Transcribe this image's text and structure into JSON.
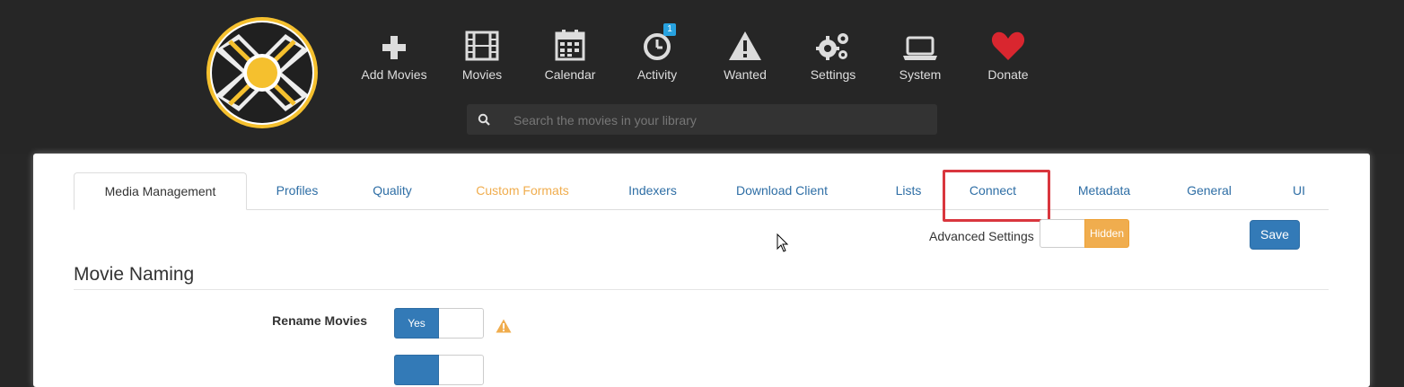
{
  "header": {
    "nav": [
      {
        "label": "Add Movies",
        "icon": "plus-icon"
      },
      {
        "label": "Movies",
        "icon": "film-icon"
      },
      {
        "label": "Calendar",
        "icon": "calendar-icon"
      },
      {
        "label": "Activity",
        "icon": "clock-icon",
        "badge": "1"
      },
      {
        "label": "Wanted",
        "icon": "warning-icon"
      },
      {
        "label": "Settings",
        "icon": "gears-icon"
      },
      {
        "label": "System",
        "icon": "laptop-icon"
      },
      {
        "label": "Donate",
        "icon": "heart-icon"
      }
    ],
    "search": {
      "placeholder": "Search the movies in your library"
    }
  },
  "tabs": [
    {
      "label": "Media Management",
      "active": true
    },
    {
      "label": "Profiles"
    },
    {
      "label": "Quality"
    },
    {
      "label": "Custom Formats"
    },
    {
      "label": "Indexers"
    },
    {
      "label": "Download Client"
    },
    {
      "label": "Lists"
    },
    {
      "label": "Connect"
    },
    {
      "label": "Metadata"
    },
    {
      "label": "General"
    },
    {
      "label": "UI"
    }
  ],
  "advanced": {
    "label": "Advanced Settings",
    "state_label": "Hidden"
  },
  "save_label": "Save",
  "section": {
    "title": "Movie Naming"
  },
  "fields": [
    {
      "label": "Rename Movies",
      "toggle_label": "Yes"
    }
  ],
  "colors": {
    "accent": "#337ab7",
    "warning": "#f0ad4e",
    "highlight": "#d9363e",
    "donate": "#d9262f",
    "badge": "#27a2e0"
  }
}
